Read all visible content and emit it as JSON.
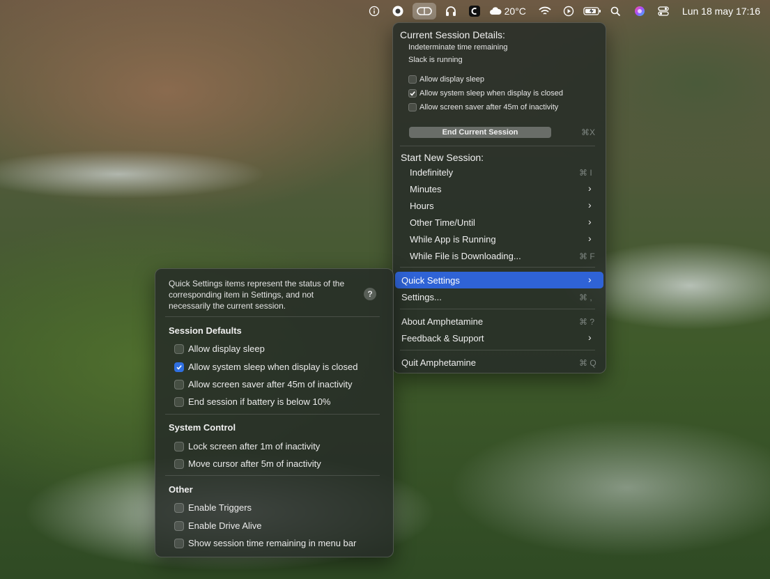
{
  "menubar": {
    "weather_temp": "20°C",
    "clock": "Lun 18 may 17:16",
    "icons": [
      "info-icon",
      "record-icon",
      "amphetamine-icon",
      "headphones-icon",
      "app-icon",
      "cloud-icon",
      "wifi-icon",
      "play-icon",
      "battery-icon",
      "search-icon",
      "siri-icon",
      "control-center-icon"
    ]
  },
  "main_menu": {
    "current_session_header": "Current Session Details:",
    "time_remaining": "Indeterminate time remaining",
    "app_running": "Slack is running",
    "options": [
      {
        "label": "Allow display sleep",
        "checked": false
      },
      {
        "label": "Allow system sleep when display is closed",
        "checked": true
      },
      {
        "label": "Allow screen saver after 45m of inactivity",
        "checked": false
      }
    ],
    "end_session_label": "End Current Session",
    "end_session_shortcut": "⌘X",
    "start_new_header": "Start New Session:",
    "start_items": [
      {
        "label": "Indefinitely",
        "shortcut": "⌘ I",
        "submenu": false
      },
      {
        "label": "Minutes",
        "shortcut": "",
        "submenu": true
      },
      {
        "label": "Hours",
        "shortcut": "",
        "submenu": true
      },
      {
        "label": "Other Time/Until",
        "shortcut": "",
        "submenu": true
      },
      {
        "label": "While App is Running",
        "shortcut": "",
        "submenu": true
      },
      {
        "label": "While File is Downloading...",
        "shortcut": "⌘ F",
        "submenu": false
      }
    ],
    "quick_settings_label": "Quick Settings",
    "settings_label": "Settings...",
    "settings_shortcut": "⌘ ,",
    "about_label": "About Amphetamine",
    "about_shortcut": "⌘ ?",
    "feedback_label": "Feedback & Support",
    "quit_label": "Quit Amphetamine",
    "quit_shortcut": "⌘ Q"
  },
  "quick_settings": {
    "description": "Quick Settings items represent the status of the corresponding item in Settings, and not necessarily the current session.",
    "help_label": "?",
    "sections": [
      {
        "title": "Session Defaults",
        "items": [
          {
            "label": "Allow display sleep",
            "checked": false
          },
          {
            "label": "Allow system sleep when display is closed",
            "checked": true
          },
          {
            "label": "Allow screen saver after 45m of inactivity",
            "checked": false
          },
          {
            "label": "End session if battery is below 10%",
            "checked": false
          }
        ]
      },
      {
        "title": "System Control",
        "items": [
          {
            "label": "Lock screen after 1m of inactivity",
            "checked": false
          },
          {
            "label": "Move cursor after 5m of inactivity",
            "checked": false
          }
        ]
      },
      {
        "title": "Other",
        "items": [
          {
            "label": "Enable Triggers",
            "checked": false
          },
          {
            "label": "Enable Drive Alive",
            "checked": false
          },
          {
            "label": "Show session time remaining in menu bar",
            "checked": false
          }
        ]
      }
    ]
  },
  "colors": {
    "highlight": "#2f63d6",
    "checkbox_checked": "#2f6fe0"
  }
}
